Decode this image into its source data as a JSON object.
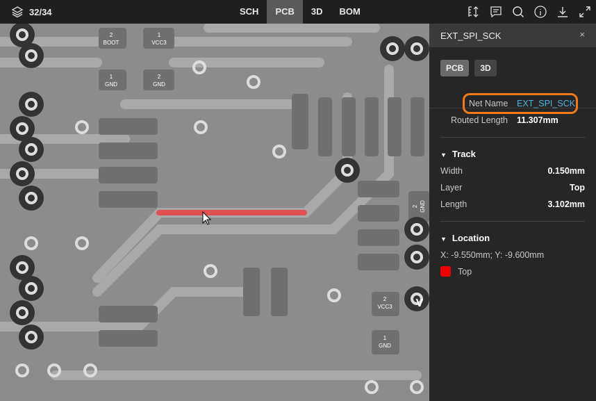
{
  "topbar": {
    "layer_count": "32/34",
    "tabs": [
      "SCH",
      "PCB",
      "3D",
      "BOM"
    ],
    "active_tab": "PCB",
    "tools": [
      "measure-icon",
      "comment-icon",
      "search-icon",
      "info-icon",
      "download-icon",
      "expand-icon"
    ]
  },
  "pcb": {
    "pad_labels": [
      [
        "2",
        "BOOT"
      ],
      [
        "1",
        "VCC3"
      ],
      [
        "1",
        "GND"
      ],
      [
        "2",
        "GND"
      ],
      [
        "2",
        "GND"
      ],
      [
        "2",
        "VCC3"
      ],
      [
        "1",
        "GND"
      ]
    ],
    "edge_text": "V",
    "highlight_color": "#e05050"
  },
  "panel": {
    "title": "EXT_SPI_SCK",
    "close": "×",
    "view_buttons": [
      "PCB",
      "3D"
    ],
    "net_name_label": "Net Name",
    "net_name": "EXT_SPI_SCK",
    "net_color": "#4fb3e0",
    "routed_length_label": "Routed Length",
    "routed_length": "11.307mm",
    "track": {
      "title": "Track",
      "rows": [
        {
          "label": "Width",
          "value": "0.150mm"
        },
        {
          "label": "Layer",
          "value": "Top"
        },
        {
          "label": "Length",
          "value": "3.102mm"
        }
      ]
    },
    "location": {
      "title": "Location",
      "coords": "X: -9.550mm; Y: -9.600mm",
      "layer": "Top",
      "layer_color": "#ee0000"
    }
  }
}
